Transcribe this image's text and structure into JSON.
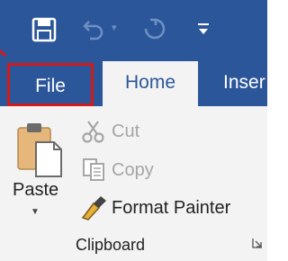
{
  "tabs": {
    "file": "File",
    "home": "Home",
    "insert": "Inser"
  },
  "clipboard": {
    "paste": "Paste",
    "cut": "Cut",
    "copy": "Copy",
    "format_painter": "Format Painter",
    "group_label": "Clipboard"
  },
  "colors": {
    "accent": "#2b579a",
    "highlight": "#d31a1a",
    "ribbon_bg": "#f3f3f3"
  },
  "icons": {
    "save": "save-icon",
    "undo": "undo-icon",
    "redo": "redo-icon",
    "customize": "customize-qat-icon",
    "paste": "paste-icon",
    "cut": "scissors-icon",
    "copy": "copy-icon",
    "format_painter": "paintbrush-icon",
    "launcher": "dialog-launcher-icon"
  }
}
